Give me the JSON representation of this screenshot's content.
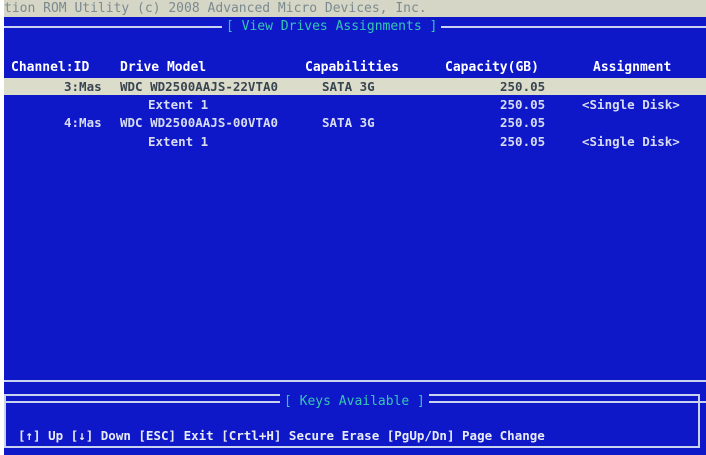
{
  "title_bar": "tion ROM Utility (c) 2008 Advanced Micro Devices, Inc.",
  "section_title": "[ View Drives Assignments ]",
  "columns": {
    "channel": "Channel:ID",
    "model": "Drive Model",
    "capabilities": "Capabilities",
    "capacity": "Capacity(GB)",
    "assignment": "Assignment"
  },
  "rows": [
    {
      "channel": "3:Mas",
      "model": "WDC WD2500AAJS-22VTA0",
      "capabilities": "SATA  3G",
      "capacity": "250.05",
      "assignment": "",
      "selected": true
    },
    {
      "channel": "",
      "model": "Extent 1",
      "capabilities": "",
      "capacity": "250.05",
      "assignment": "<Single Disk>",
      "selected": false
    },
    {
      "channel": "4:Mas",
      "model": "WDC WD2500AAJS-00VTA0",
      "capabilities": "SATA  3G",
      "capacity": "250.05",
      "assignment": "",
      "selected": false
    },
    {
      "channel": "",
      "model": "Extent 1",
      "capabilities": "",
      "capacity": "250.05",
      "assignment": "<Single Disk>",
      "selected": false
    }
  ],
  "keys_title": "[ Keys Available ]",
  "keys_help": "[↑] Up [↓] Down [ESC] Exit [Crtl+H] Secure Erase [PgUp/Dn] Page Change",
  "colors": {
    "background": "#0f18c8",
    "title_bar": "#d6d6c6",
    "section_label": "#34c7b4",
    "selected_row": "#dcdccb"
  }
}
